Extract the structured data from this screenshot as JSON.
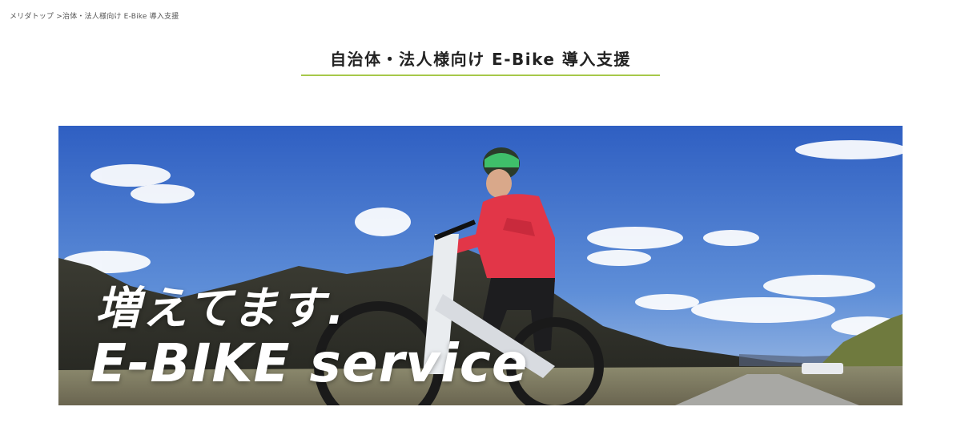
{
  "breadcrumb": {
    "home": "メリダトップ",
    "separator": ">",
    "current": "治体・法人様向け E-Bike 導入支援"
  },
  "page": {
    "title": "自治体・法人様向け E-Bike 導入支援"
  },
  "hero": {
    "line1": "増えてます.",
    "line2": "E-BIKE service"
  },
  "colors": {
    "title_underline": "#a6c84a",
    "sky": "#3a66c4",
    "jacket": "#e23648"
  }
}
